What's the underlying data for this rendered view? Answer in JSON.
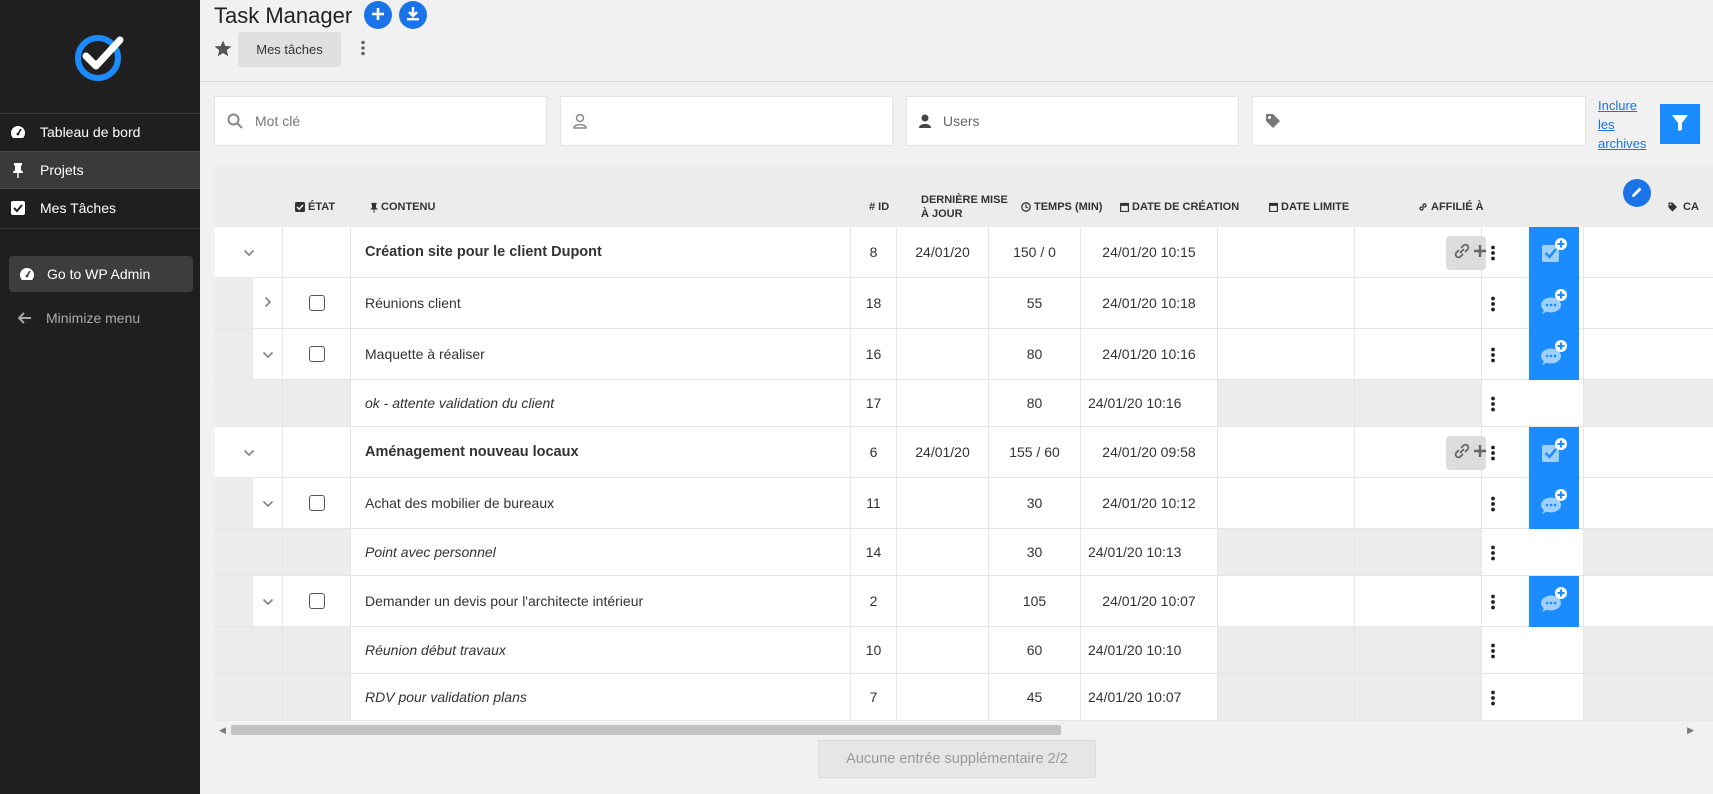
{
  "app": {
    "title": "Task Manager",
    "tab": "Mes tâches"
  },
  "sidebar": {
    "items": [
      {
        "label": "Tableau de bord",
        "icon": "dashboard-icon"
      },
      {
        "label": "Projets",
        "icon": "pin-icon",
        "active": true
      },
      {
        "label": "Mes Tâches",
        "icon": "checkbox-icon"
      }
    ],
    "wp_admin": "Go to WP Admin",
    "minimize": "Minimize menu"
  },
  "filters": {
    "keyword_placeholder": "Mot clé",
    "user_placeholder": "",
    "users_placeholder": "Users",
    "tags_placeholder": "",
    "archives_line1": "Inclure",
    "archives_line2": "les",
    "archives_line3": "archives"
  },
  "table": {
    "headers": {
      "etat": "ÉTAT",
      "contenu": "CONTENU",
      "id": "# ID",
      "maj_line1": "DERNIÈRE MISE",
      "maj_line2": "À JOUR",
      "temps": "TEMPS (MIN)",
      "creation": "DATE DE CRÉATION",
      "limite": "DATE LIMITE",
      "affilie": "AFFILIÉ À",
      "ca": "CA"
    },
    "rows": [
      {
        "type": "project",
        "content": "Création site pour le client Dupont",
        "id": "8",
        "maj": "24/01/20",
        "temps": "150 / 0",
        "creation": "24/01/20 10:15"
      },
      {
        "type": "task",
        "expand": "right",
        "content": "Réunions client",
        "id": "18",
        "maj": "",
        "temps": "55",
        "creation": "24/01/20 10:18"
      },
      {
        "type": "task",
        "expand": "down",
        "content": "Maquette à réaliser",
        "id": "16",
        "maj": "",
        "temps": "80",
        "creation": "24/01/20 10:16"
      },
      {
        "type": "comment",
        "content": "ok - attente validation du client",
        "id": "17",
        "temps": "80",
        "creation": "24/01/20 10:16"
      },
      {
        "type": "project",
        "content": "Aménagement nouveau locaux",
        "id": "6",
        "maj": "24/01/20",
        "temps": "155 / 60",
        "creation": "24/01/20 09:58"
      },
      {
        "type": "task",
        "expand": "down",
        "content": "Achat des mobilier de bureaux",
        "id": "11",
        "maj": "",
        "temps": "30",
        "creation": "24/01/20 10:12"
      },
      {
        "type": "comment",
        "content": "Point avec personnel",
        "id": "14",
        "temps": "30",
        "creation": "24/01/20 10:13"
      },
      {
        "type": "task",
        "expand": "down",
        "content": "Demander un devis pour l'architecte intérieur",
        "id": "2",
        "maj": "",
        "temps": "105",
        "creation": "24/01/20 10:07"
      },
      {
        "type": "comment",
        "content": "Réunion début travaux",
        "id": "10",
        "temps": "60",
        "creation": "24/01/20 10:10"
      },
      {
        "type": "comment",
        "content": "RDV pour validation plans",
        "id": "7",
        "temps": "45",
        "creation": "24/01/20 10:07"
      }
    ]
  },
  "footer": {
    "more_label": "Aucune entrée supplémentaire 2/2"
  },
  "colors": {
    "accent": "#1a8cff",
    "sidebar_bg": "#1f1f1f"
  }
}
